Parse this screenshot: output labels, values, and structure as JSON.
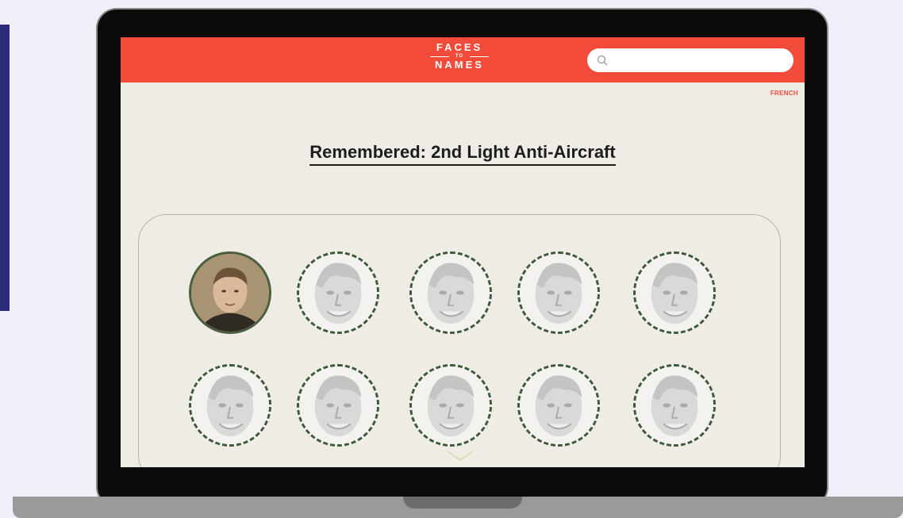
{
  "site": {
    "logo_line1": "FACES",
    "logo_line2": "TO",
    "logo_line3": "NAMES",
    "search": {
      "placeholder": "",
      "value": "",
      "icon": "search-icon"
    },
    "language_link": "FRENCH",
    "brand_color": "#f24b3a"
  },
  "main": {
    "title": "Remembered: 2nd Light Anti-Aircraft",
    "portraits": [
      {
        "type": "photo"
      },
      {
        "type": "placeholder"
      },
      {
        "type": "placeholder"
      },
      {
        "type": "placeholder"
      },
      {
        "type": "placeholder"
      },
      {
        "type": "placeholder"
      },
      {
        "type": "placeholder"
      },
      {
        "type": "placeholder"
      },
      {
        "type": "placeholder"
      },
      {
        "type": "placeholder"
      }
    ],
    "scroll_indicator": "chevron-down-icon"
  }
}
